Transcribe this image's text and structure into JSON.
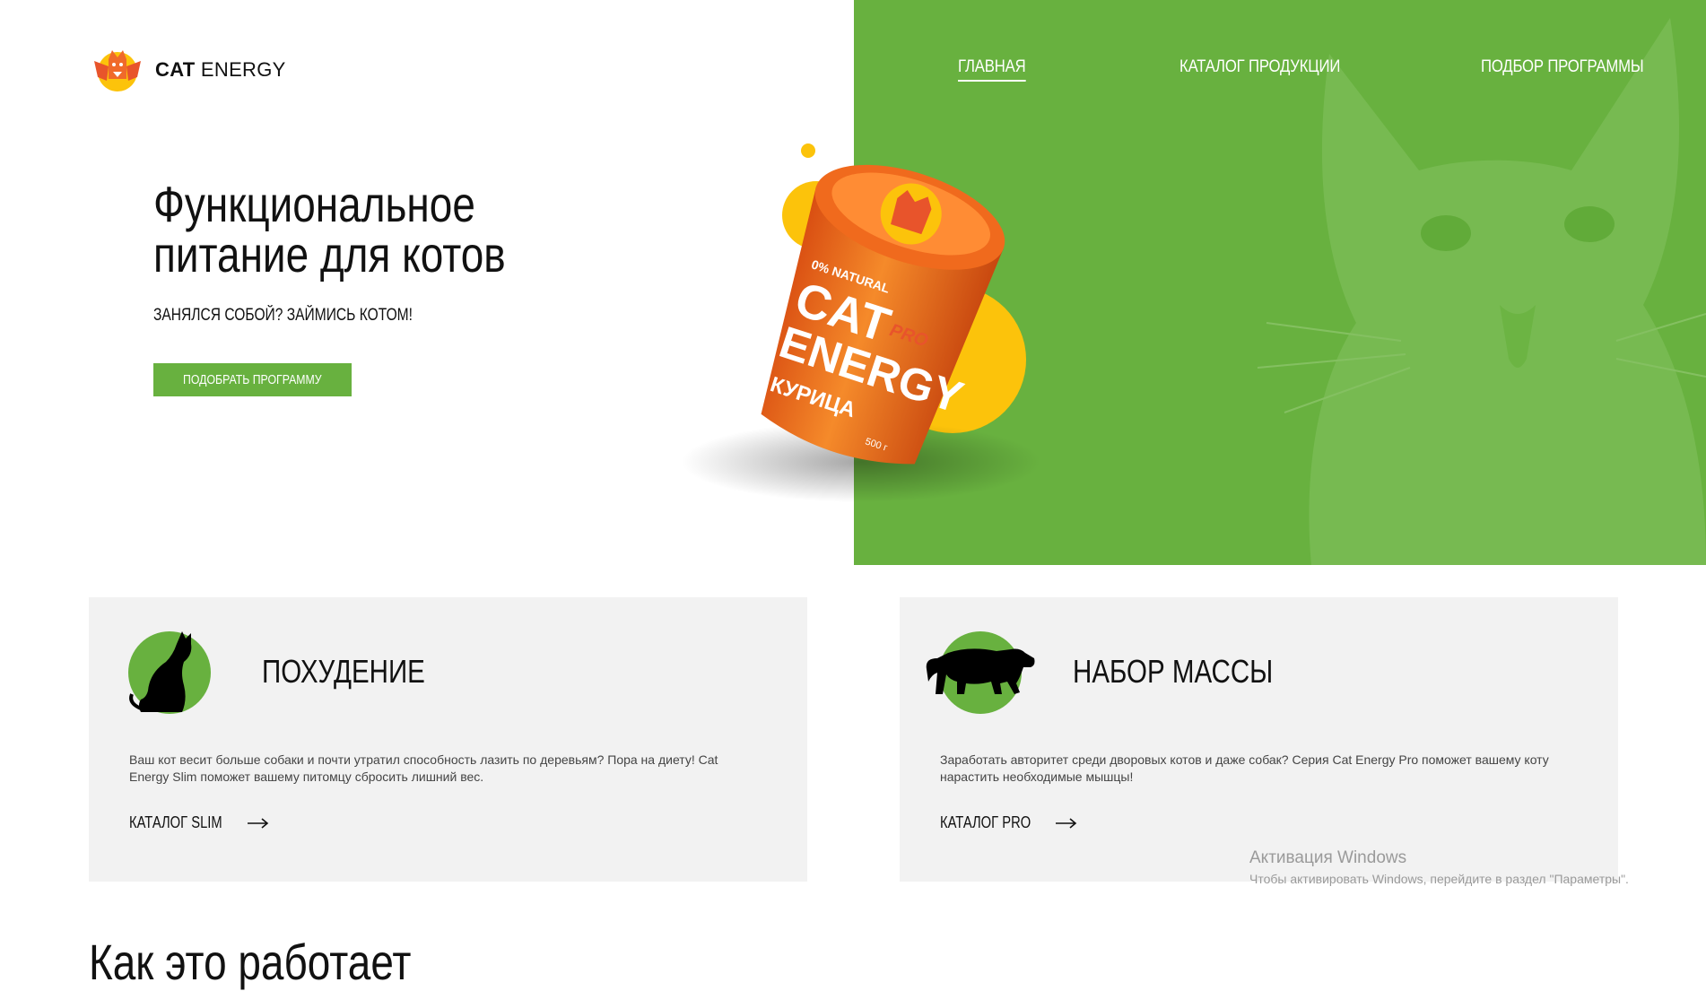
{
  "logo": {
    "brand_bold": "CAT",
    "brand_light": "ENERGY",
    "icon": "cat-energy-logo-icon"
  },
  "nav": {
    "items": [
      {
        "label": "ГЛАВНАЯ",
        "active": true
      },
      {
        "label": "КАТАЛОГ ПРОДУКЦИИ",
        "active": false
      },
      {
        "label": "ПОДБОР ПРОГРАММЫ",
        "active": false
      }
    ]
  },
  "hero": {
    "title_line1": "Функциональное",
    "title_line2": "питание для котов",
    "subtitle": "ЗАНЯЛСЯ СОБОЙ? ЗАЙМИСЬ КОТОМ!",
    "button": "ПОДОБРАТЬ ПРОГРАММУ"
  },
  "product": {
    "label_natural": "0% NATURAL",
    "label_brand1": "CAT",
    "label_brand2": "ENERGY",
    "label_pro": "PRO",
    "label_flavor": "КУРИЦА",
    "label_weight": "500 г"
  },
  "cards": [
    {
      "title": "ПОХУДЕНИЕ",
      "text": "Ваш кот весит больше собаки и почти утратил способность лазить по деревьям? Пора на диету! Cat Energy Slim поможет вашему питомцу сбросить лишний вес.",
      "link": "КАТАЛОГ SLIM",
      "icon": "sitting-cat-icon"
    },
    {
      "title": "НАБОР МАССЫ",
      "text": "Заработать авторитет среди дворовых котов и даже собак? Серия Cat Energy Pro поможет вашему коту нарастить необходимые мышцы!",
      "link": "КАТАЛОГ PRO",
      "icon": "panther-icon"
    }
  ],
  "next_section_title": "Как это работает",
  "watermark": {
    "line1": "Активация Windows",
    "line2": "Чтобы активировать Windows, перейдите в раздел \"Параметры\"."
  },
  "colors": {
    "green": "#68b13f",
    "yellow": "#fcc30b",
    "orange": "#f07b1d",
    "card_bg": "#f2f2f2"
  }
}
